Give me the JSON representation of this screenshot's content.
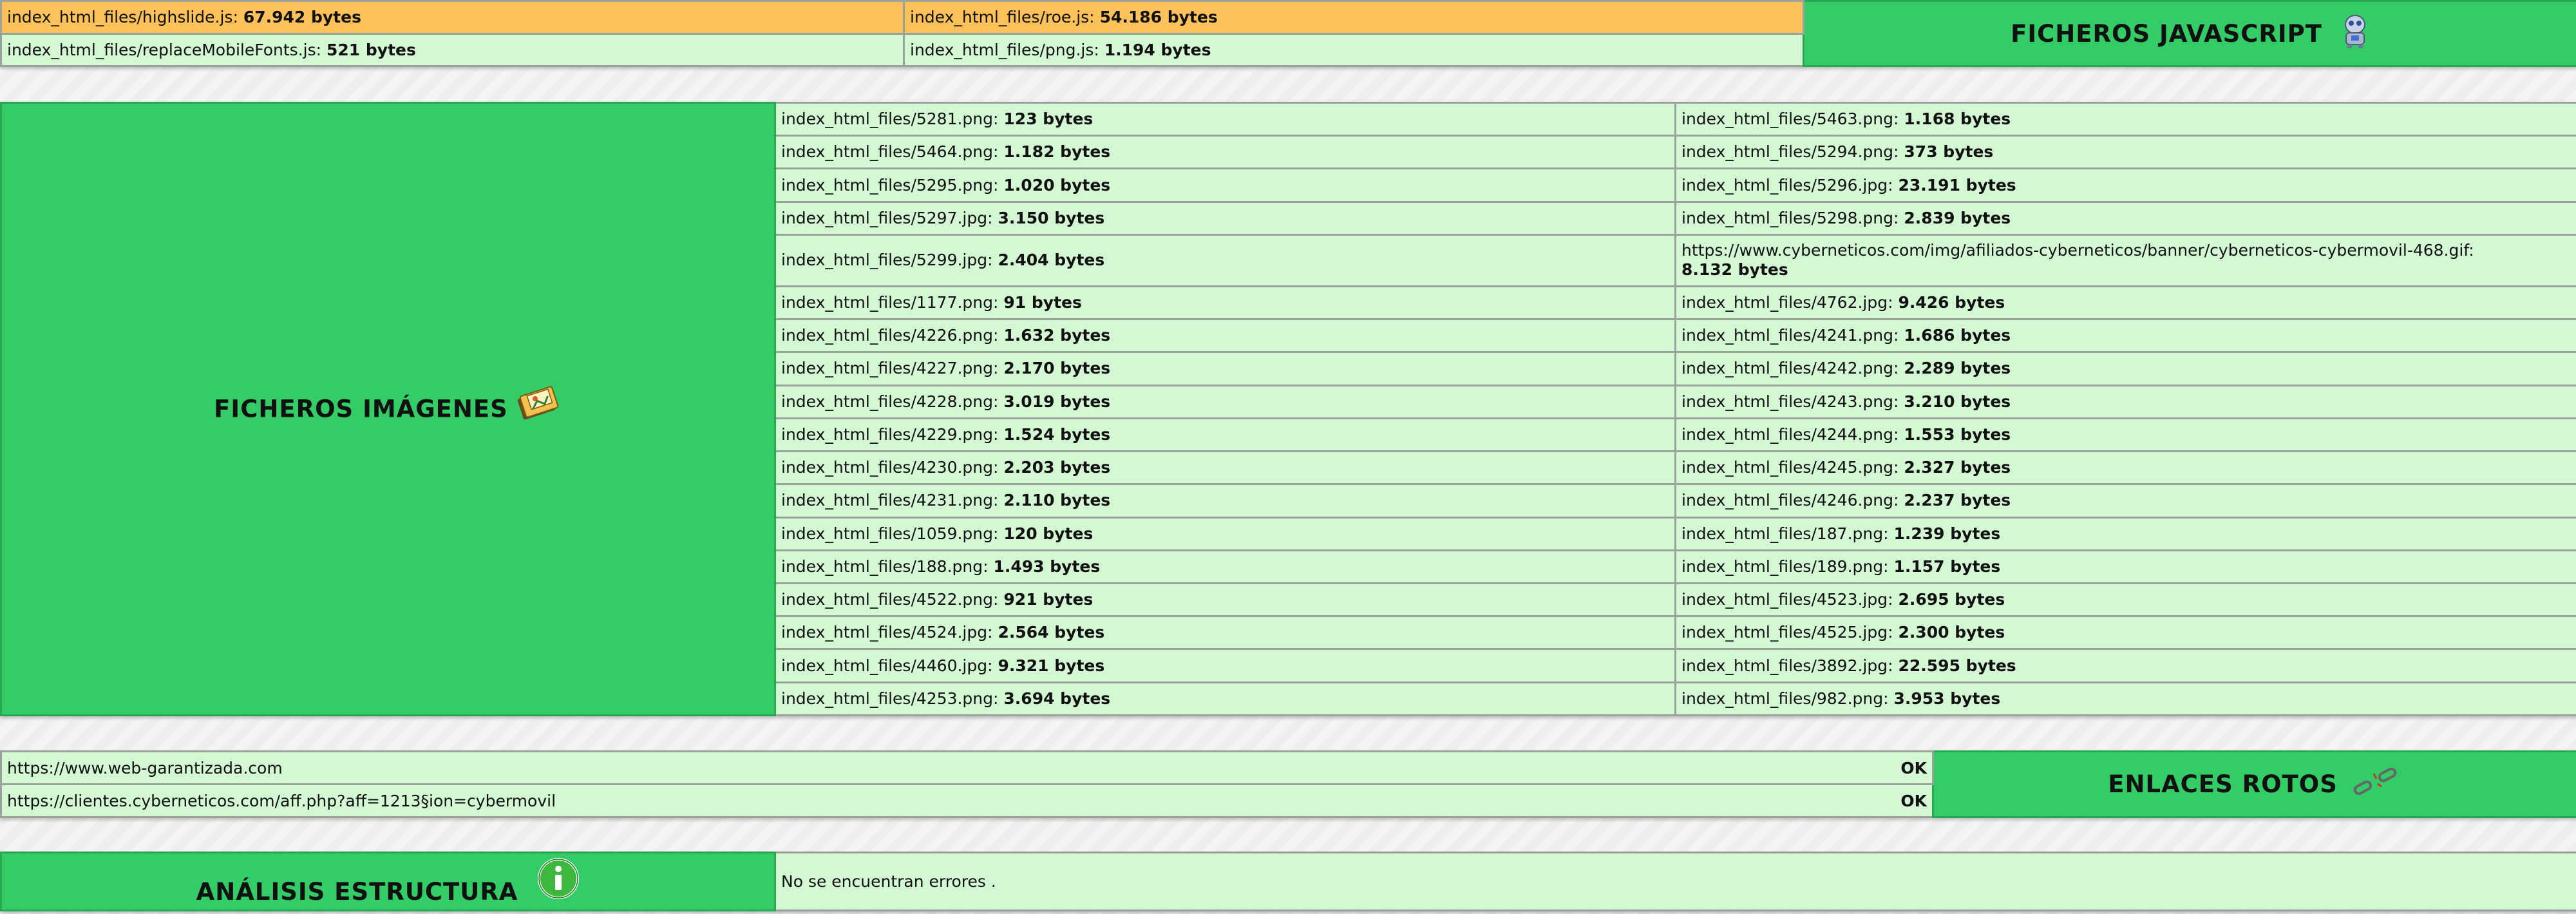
{
  "javascript": {
    "title": "FICHEROS JAVASCRIPT",
    "icon": "javascript-robot-icon",
    "files": [
      {
        "name": "index_html_files/highslide.js:",
        "size": "67.942 bytes"
      },
      {
        "name": "index_html_files/roe.js:",
        "size": "54.186 bytes"
      },
      {
        "name": "index_html_files/replaceMobileFonts.js:",
        "size": "521 bytes"
      },
      {
        "name": "index_html_files/png.js:",
        "size": "1.194 bytes"
      }
    ]
  },
  "images": {
    "title": "FICHEROS IMÁGENES",
    "icon": "images-folder-icon",
    "rows": [
      [
        {
          "name": "index_html_files/5281.png:",
          "size": "123 bytes"
        },
        {
          "name": "index_html_files/5463.png:",
          "size": "1.168 bytes"
        }
      ],
      [
        {
          "name": "index_html_files/5464.png:",
          "size": "1.182 bytes"
        },
        {
          "name": "index_html_files/5294.png:",
          "size": "373 bytes"
        }
      ],
      [
        {
          "name": "index_html_files/5295.png:",
          "size": "1.020 bytes"
        },
        {
          "name": "index_html_files/5296.jpg:",
          "size": "23.191 bytes"
        }
      ],
      [
        {
          "name": "index_html_files/5297.jpg:",
          "size": "3.150 bytes"
        },
        {
          "name": "index_html_files/5298.png:",
          "size": "2.839 bytes"
        }
      ],
      [
        {
          "name": "index_html_files/5299.jpg:",
          "size": "2.404 bytes"
        },
        {
          "name": "https://www.cyberneticos.com/img/afiliados-cyberneticos/banner/cyberneticos-cybermovil-468.gif:",
          "size": "8.132 bytes"
        }
      ],
      [
        {
          "name": "index_html_files/1177.png:",
          "size": "91 bytes"
        },
        {
          "name": "index_html_files/4762.jpg:",
          "size": "9.426 bytes"
        }
      ],
      [
        {
          "name": "index_html_files/4226.png:",
          "size": "1.632 bytes"
        },
        {
          "name": "index_html_files/4241.png:",
          "size": "1.686 bytes"
        }
      ],
      [
        {
          "name": "index_html_files/4227.png:",
          "size": "2.170 bytes"
        },
        {
          "name": "index_html_files/4242.png:",
          "size": "2.289 bytes"
        }
      ],
      [
        {
          "name": "index_html_files/4228.png:",
          "size": "3.019 bytes"
        },
        {
          "name": "index_html_files/4243.png:",
          "size": "3.210 bytes"
        }
      ],
      [
        {
          "name": "index_html_files/4229.png:",
          "size": "1.524 bytes"
        },
        {
          "name": "index_html_files/4244.png:",
          "size": "1.553 bytes"
        }
      ],
      [
        {
          "name": "index_html_files/4230.png:",
          "size": "2.203 bytes"
        },
        {
          "name": "index_html_files/4245.png:",
          "size": "2.327 bytes"
        }
      ],
      [
        {
          "name": "index_html_files/4231.png:",
          "size": "2.110 bytes"
        },
        {
          "name": "index_html_files/4246.png:",
          "size": "2.237 bytes"
        }
      ],
      [
        {
          "name": "index_html_files/1059.png:",
          "size": "120 bytes"
        },
        {
          "name": "index_html_files/187.png:",
          "size": "1.239 bytes"
        }
      ],
      [
        {
          "name": "index_html_files/188.png:",
          "size": "1.493 bytes"
        },
        {
          "name": "index_html_files/189.png:",
          "size": "1.157 bytes"
        }
      ],
      [
        {
          "name": "index_html_files/4522.png:",
          "size": "921 bytes"
        },
        {
          "name": "index_html_files/4523.jpg:",
          "size": "2.695 bytes"
        }
      ],
      [
        {
          "name": "index_html_files/4524.jpg:",
          "size": "2.564 bytes"
        },
        {
          "name": "index_html_files/4525.jpg:",
          "size": "2.300 bytes"
        }
      ],
      [
        {
          "name": "index_html_files/4460.jpg:",
          "size": "9.321 bytes"
        },
        {
          "name": "index_html_files/3892.jpg:",
          "size": "22.595 bytes"
        }
      ],
      [
        {
          "name": "index_html_files/4253.png:",
          "size": "3.694 bytes"
        },
        {
          "name": "index_html_files/982.png:",
          "size": "3.953 bytes"
        }
      ]
    ]
  },
  "links": {
    "title": "ENLACES ROTOS",
    "icon": "broken-chain-icon",
    "items": [
      {
        "url": "https://www.web-garantizada.com",
        "status": "OK"
      },
      {
        "url": "https://clientes.cyberneticos.com/aff.php?aff=1213§ion=cybermovil",
        "status": "OK"
      }
    ]
  },
  "structure": {
    "title": "ANÁLISIS ESTRUCTURA",
    "icon": "info-icon",
    "message": "No se encuentran errores ."
  },
  "colors": {
    "section_green": "#33cc66",
    "row_light_green": "#d3f8d3",
    "highlight_orange": "#ffc25a"
  }
}
